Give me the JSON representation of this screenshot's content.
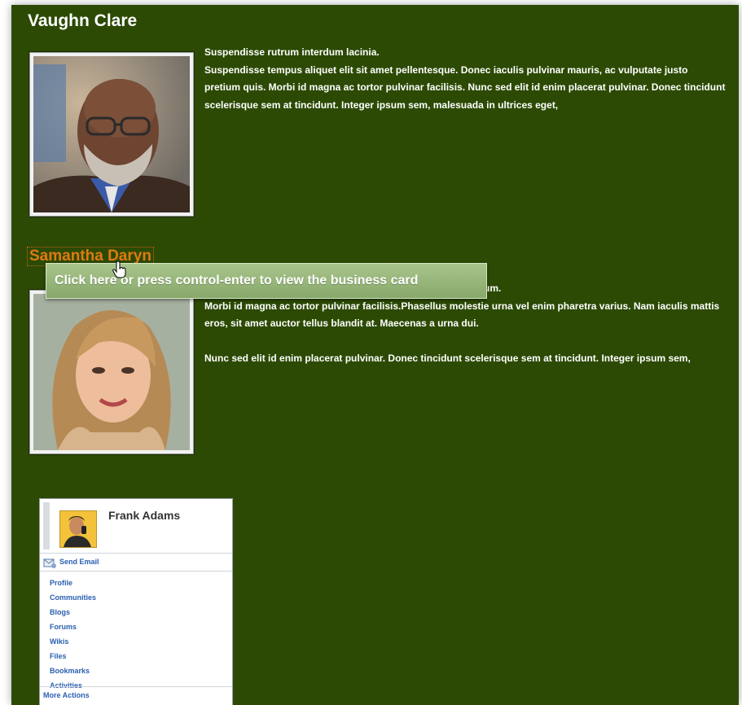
{
  "people": [
    {
      "name": "Vaughn Clare",
      "lead": "Suspendisse rutrum interdum lacinia.",
      "paragraphs": [
        "Suspendisse tempus aliquet elit sit amet pellentesque. Donec iaculis pulvinar mauris, ac vulputate justo pretium quis. Morbi id magna ac tortor pulvinar facilisis. Nunc sed elit id enim placerat pulvinar. Donec tincidunt scelerisque sem at tincidunt. Integer ipsum sem, malesuada in ultrices eget,"
      ]
    },
    {
      "name": "Samantha Daryn",
      "lead_tail": "um.",
      "paragraphs": [
        "Morbi id magna ac tortor pulvinar facilisis.Phasellus molestie urna vel enim pharetra varius. Nam iaculis mattis eros, sit amet auctor tellus blandit at. Maecenas a urna dui.",
        "Nunc sed elit id enim placerat pulvinar. Donec tincidunt scelerisque sem at tincidunt. Integer ipsum sem,"
      ]
    }
  ],
  "tooltip": {
    "text": "Click here or press control-enter to view the business card"
  },
  "business_card": {
    "name": "Frank Adams",
    "send_email": "Send Email",
    "links": [
      "Profile",
      "Communities",
      "Blogs",
      "Forums",
      "Wikis",
      "Files",
      "Bookmarks",
      "Activities"
    ],
    "more_actions": "More Actions"
  },
  "colors": {
    "background": "#2c4a04",
    "link": "#e07a10",
    "tooltip": "#9bb87e",
    "card_link": "#2a5fb0"
  }
}
